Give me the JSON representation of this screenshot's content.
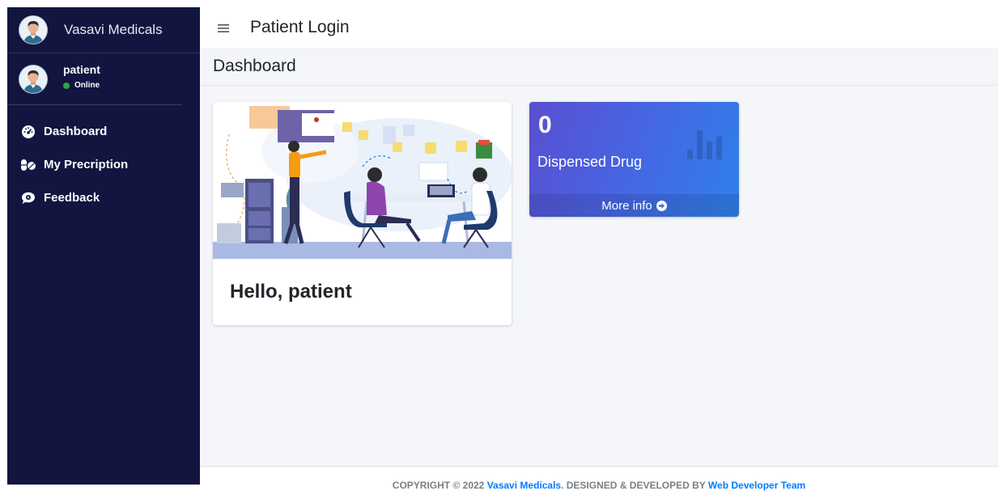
{
  "sidebar": {
    "brand": "Vasavi Medicals",
    "user": {
      "name": "patient",
      "status": "Online"
    },
    "items": [
      {
        "label": "Dashboard",
        "icon": "tachometer-icon"
      },
      {
        "label": "My Precription",
        "icon": "pills-icon"
      },
      {
        "label": "Feedback",
        "icon": "comment-icon"
      }
    ]
  },
  "topbar": {
    "title": "Patient Login"
  },
  "content": {
    "header": "Dashboard",
    "welcome_card": {
      "text": "Hello, patient"
    },
    "stat_box": {
      "value": "0",
      "label": "Dispensed Drug",
      "link": "More info"
    }
  },
  "footer": {
    "prefix": "COPYRIGHT © 2022 ",
    "link1": "Vasavi Medicals",
    "middle": ". DESIGNED & DEVELOPED BY ",
    "link2": "Web Developer Team"
  },
  "colors": {
    "sidebar_bg": "#111540",
    "stat_gradient_start": "#5a4fd0",
    "stat_gradient_end": "#2e80ea",
    "online": "#28a745"
  }
}
